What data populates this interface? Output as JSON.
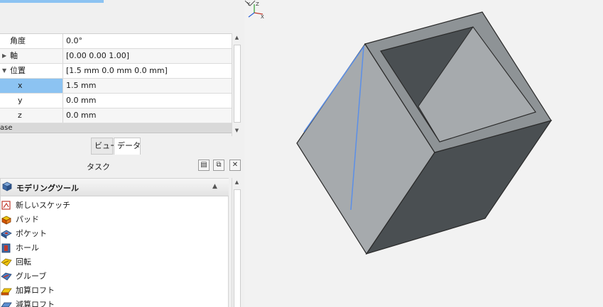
{
  "properties": {
    "rows": [
      {
        "name": "角度",
        "value": "0.0°"
      },
      {
        "name": "軸",
        "value": "[0.00 0.00 1.00]"
      },
      {
        "name": "位置",
        "value": "[1.5 mm  0.0 mm  0.0 mm]"
      },
      {
        "name": "x",
        "value": "1.5 mm"
      },
      {
        "name": "y",
        "value": "0.0 mm"
      },
      {
        "name": "z",
        "value": "0.0 mm"
      }
    ],
    "group_label": "ase"
  },
  "tabs": {
    "view": "ビュー",
    "data": "データ"
  },
  "task_panel": {
    "title": "タスク",
    "group_title": "モデリングツール",
    "items": [
      {
        "label": "新しいスケッチ",
        "icon": "sketch-icon"
      },
      {
        "label": "パッド",
        "icon": "pad-icon"
      },
      {
        "label": "ポケット",
        "icon": "pocket-icon"
      },
      {
        "label": "ホール",
        "icon": "hole-icon"
      },
      {
        "label": "回転",
        "icon": "revolve-icon"
      },
      {
        "label": "グルーブ",
        "icon": "groove-icon"
      },
      {
        "label": "加算ロフト",
        "icon": "additive-loft-icon"
      },
      {
        "label": "減算ロフト",
        "icon": "subtractive-loft-icon"
      }
    ]
  },
  "colors": {
    "selection": "#8cc3f2",
    "face_light": "#a6aaad",
    "face_dark": "#4a4f52",
    "edge_highlight": "#5b8fe8"
  }
}
